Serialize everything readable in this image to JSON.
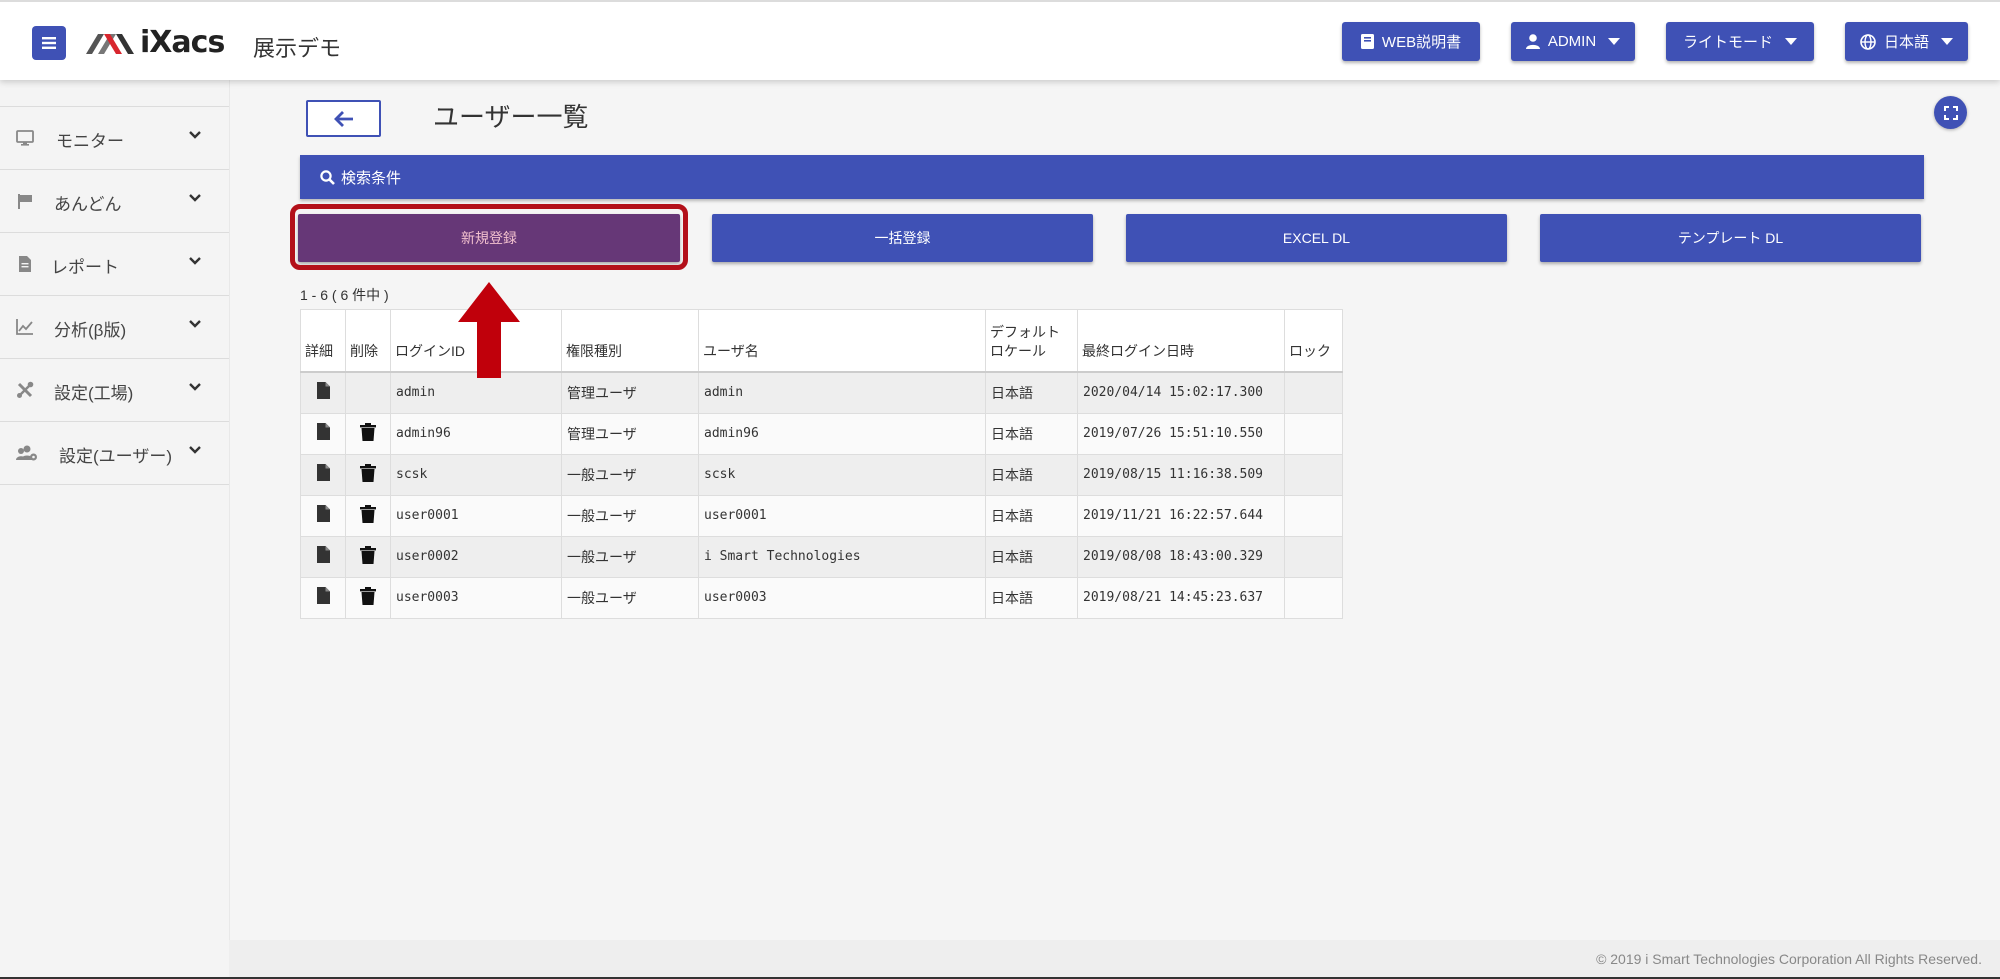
{
  "header": {
    "site_title": "展示デモ",
    "logo_text": "iXacs",
    "web_manual": "WEB説明書",
    "user_menu": "ADMIN",
    "theme_menu": "ライトモード",
    "language_menu": "日本語"
  },
  "sidebar": {
    "items": [
      {
        "label": "モニター",
        "icon": "monitor-icon"
      },
      {
        "label": "あんどん",
        "icon": "flag-icon"
      },
      {
        "label": "レポート",
        "icon": "file-icon"
      },
      {
        "label": "分析(β版)",
        "icon": "chart-icon"
      },
      {
        "label": "設定(工場)",
        "icon": "tools-icon"
      },
      {
        "label": "設定(ユーザー)",
        "icon": "users-cog-icon"
      }
    ]
  },
  "main": {
    "page_title": "ユーザー一覧",
    "search_label": "検索条件",
    "actions": {
      "new_register": "新規登録",
      "bulk_register": "一括登録",
      "excel_dl": "EXCEL DL",
      "template_dl": "テンプレート DL"
    },
    "record_count": "1 - 6 ( 6 件中 )",
    "table": {
      "headers": {
        "detail": "詳細",
        "delete": "削除",
        "login_id": "ログインID",
        "role": "権限種別",
        "user_name": "ユーザ名",
        "locale_line1": "デフォルト",
        "locale_line2": "ロケール",
        "last_login": "最終ログイン日時",
        "lock": "ロック"
      },
      "rows": [
        {
          "login_id": "admin",
          "role": "管理ユーザ",
          "user_name": "admin",
          "locale": "日本語",
          "last_login": "2020/04/14 15:02:17.300",
          "lock": "",
          "deletable": false
        },
        {
          "login_id": "admin96",
          "role": "管理ユーザ",
          "user_name": "admin96",
          "locale": "日本語",
          "last_login": "2019/07/26 15:51:10.550",
          "lock": "",
          "deletable": true
        },
        {
          "login_id": "scsk",
          "role": "一般ユーザ",
          "user_name": "scsk",
          "locale": "日本語",
          "last_login": "2019/08/15 11:16:38.509",
          "lock": "",
          "deletable": true
        },
        {
          "login_id": "user0001",
          "role": "一般ユーザ",
          "user_name": "user0001",
          "locale": "日本語",
          "last_login": "2019/11/21 16:22:57.644",
          "lock": "",
          "deletable": true
        },
        {
          "login_id": "user0002",
          "role": "一般ユーザ",
          "user_name": "i Smart Technologies",
          "locale": "日本語",
          "last_login": "2019/08/08 18:43:00.329",
          "lock": "",
          "deletable": true
        },
        {
          "login_id": "user0003",
          "role": "一般ユーザ",
          "user_name": "user0003",
          "locale": "日本語",
          "last_login": "2019/08/21 14:45:23.637",
          "lock": "",
          "deletable": true
        }
      ]
    }
  },
  "footer": {
    "copyright": "© 2019 i Smart Technologies Corporation All Rights Reserved."
  },
  "colors": {
    "primary": "#3f51b5",
    "highlight_button": "#663777",
    "highlight_ring": "#b3101a"
  }
}
